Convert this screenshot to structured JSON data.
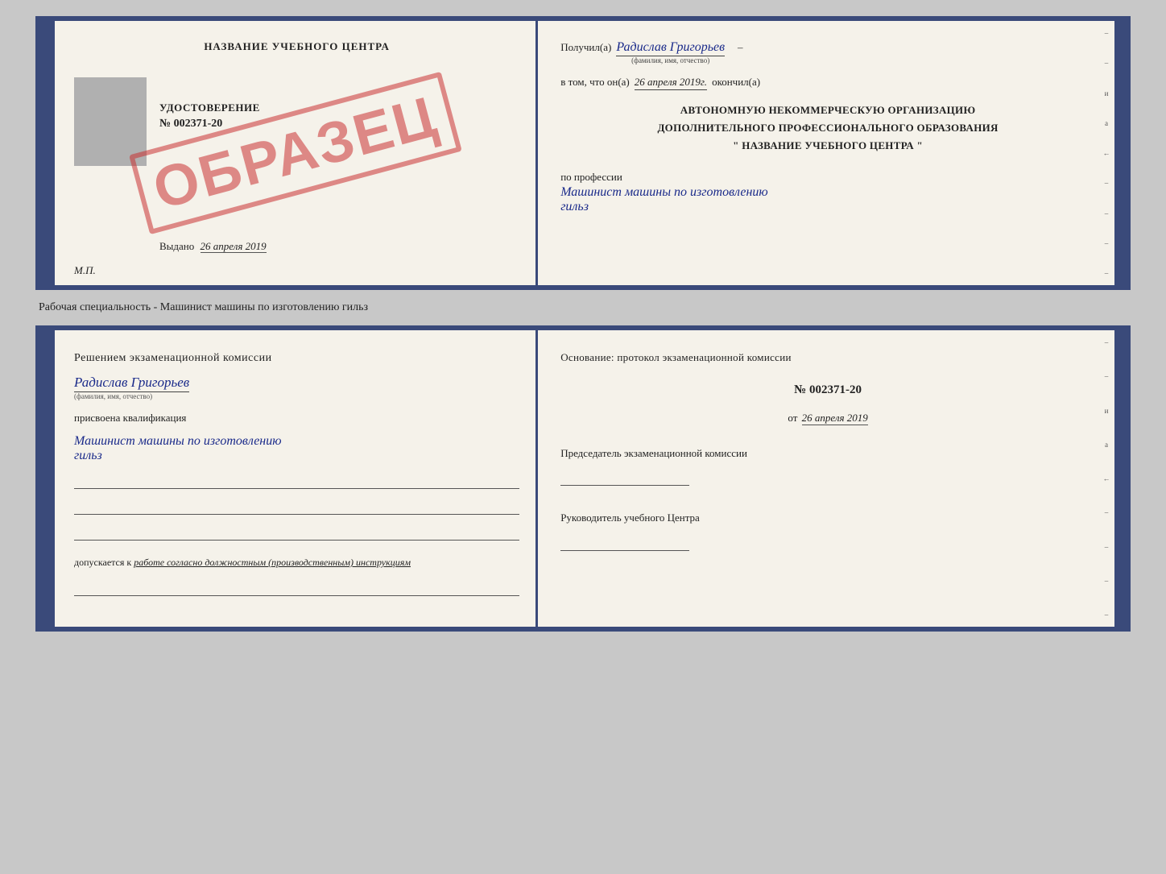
{
  "top_book": {
    "left": {
      "center_title": "НАЗВАНИЕ УЧЕБНОГО ЦЕНТРА",
      "photo_alt": "photo",
      "udost_label": "УДОСТОВЕРЕНИЕ",
      "udost_number": "№ 002371-20",
      "vudano_text": "Выдано",
      "vudano_date": "26 апреля 2019",
      "mp_label": "М.П.",
      "obrazec": "ОБРАЗЕЦ"
    },
    "right": {
      "poluchil_label": "Получил(а)",
      "person_name": "Радислав Григорьев",
      "name_subtitle": "(фамилия, имя, отчество)",
      "vtom_prefix": "в том, что он(а)",
      "date_value": "26 апреля 2019г.",
      "okончил": "окончил(а)",
      "org_line1": "АВТОНОМНУЮ НЕКОММЕРЧЕСКУЮ ОРГАНИЗАЦИЮ",
      "org_line2": "ДОПОЛНИТЕЛЬНОГО ПРОФЕССИОНАЛЬНОГО ОБРАЗОВАНИЯ",
      "org_line3": "\"   НАЗВАНИЕ УЧЕБНОГО ЦЕНТРА   \"",
      "i_label": "и",
      "a_label": "а",
      "arrow_label": "←",
      "profession_label": "по профессии",
      "profession_name": "Машинист машины по изготовлению",
      "profession_name2": "гильз"
    }
  },
  "between_label": "Рабочая специальность - Машинист машины по изготовлению гильз",
  "bottom_book": {
    "left": {
      "resheniem_title": "Решением  экзаменационной  комиссии",
      "person_name": "Радислав Григорьев",
      "name_subtitle": "(фамилия, имя, отчество)",
      "prisvoena_label": "присвоена квалификация",
      "qualification_name": "Машинист машины по изготовлению",
      "qualification_name2": "гильз",
      "dopuskaetsya_prefix": "допускается к",
      "dopuskaetsya_text": "работе согласно должностным (производственным) инструкциям"
    },
    "right": {
      "osnovanie_label": "Основание: протокол экзаменационной комиссии",
      "protocol_number": "№  002371-20",
      "protocol_date_prefix": "от",
      "protocol_date": "26 апреля 2019",
      "chairman_label": "Председатель экзаменационной комиссии",
      "rukovoditel_label": "Руководитель учебного Центра",
      "i_label": "и",
      "a_label": "а",
      "arrow_label": "←"
    }
  }
}
